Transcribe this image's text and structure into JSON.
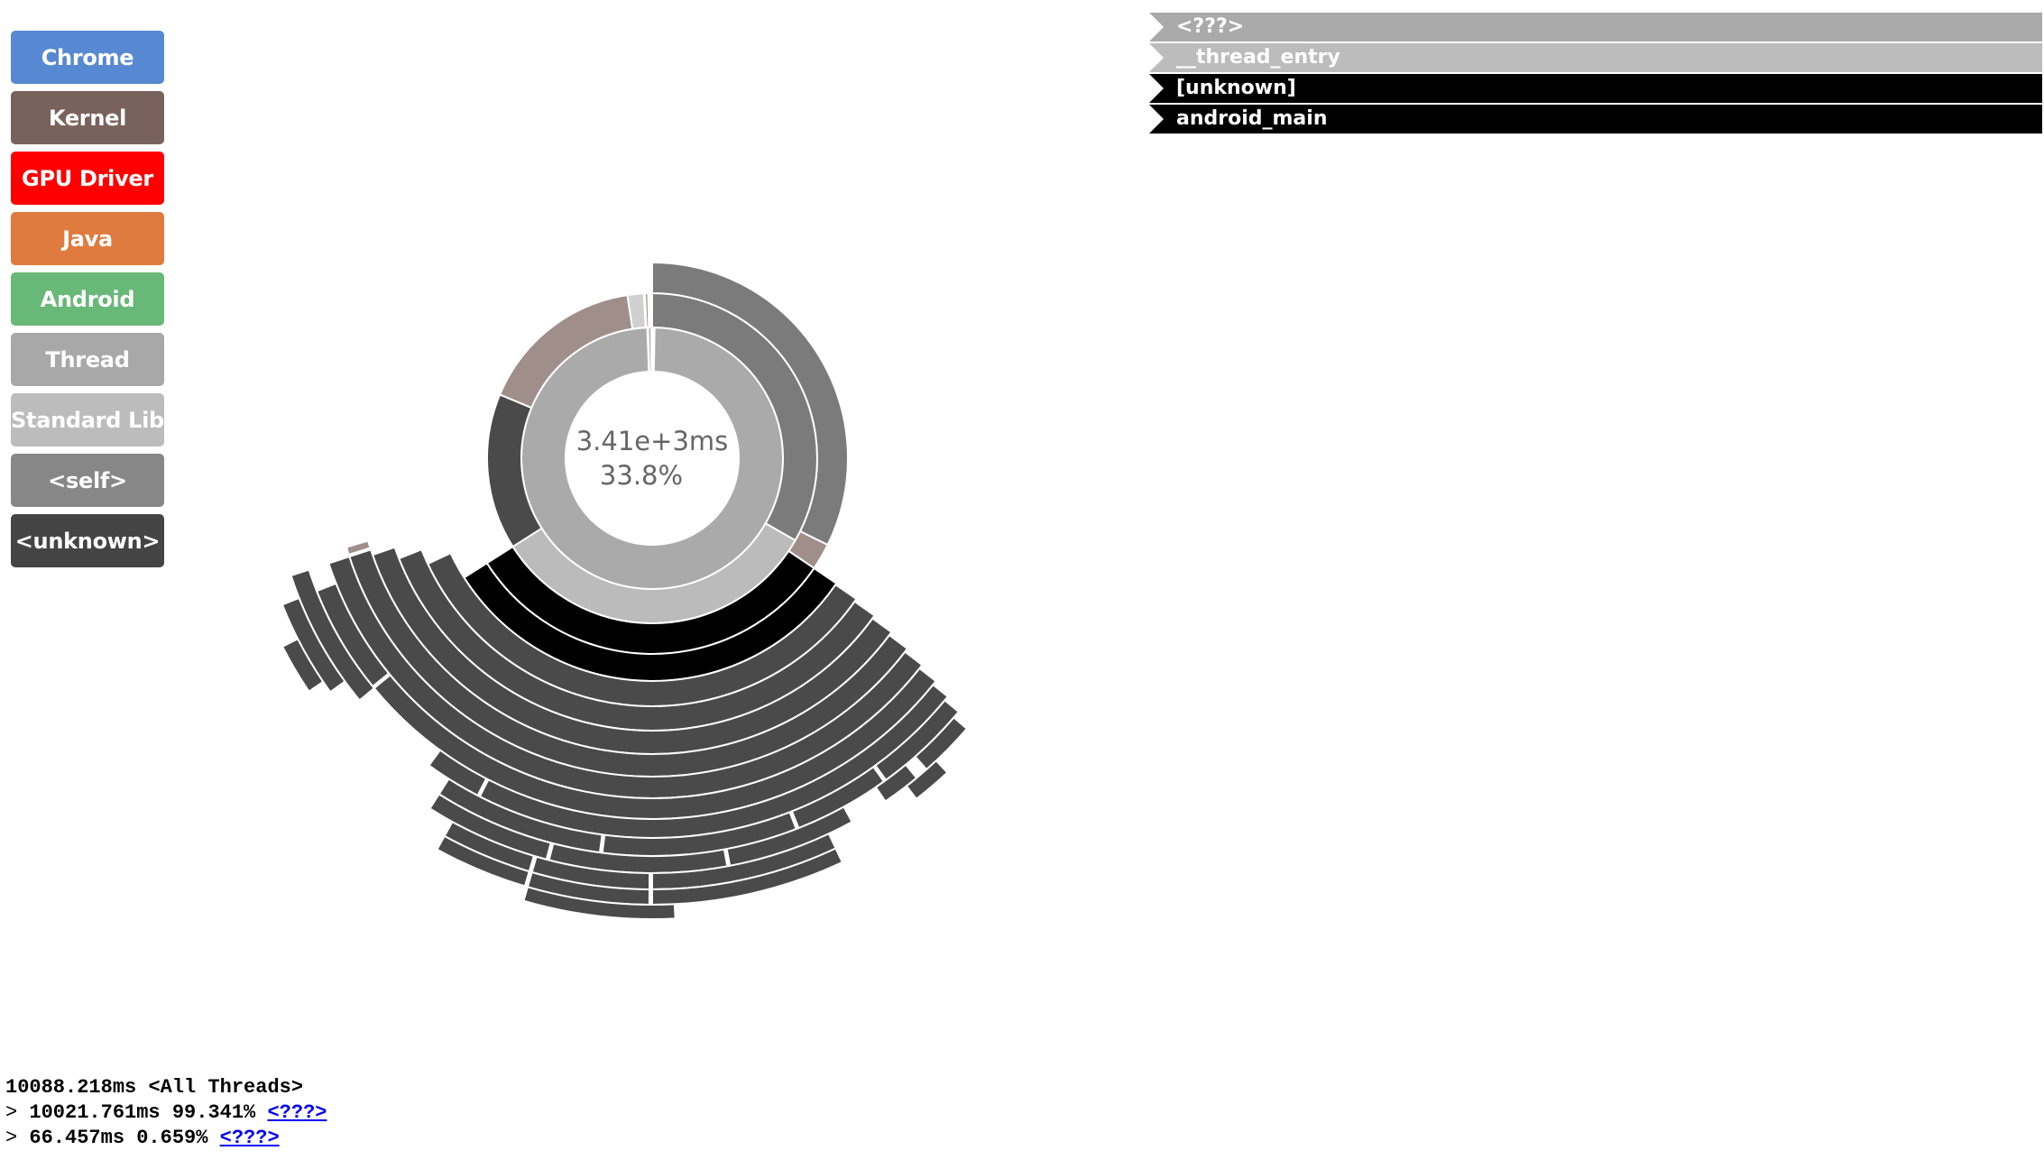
{
  "legend": [
    {
      "label": "Chrome",
      "color": "#5689d1"
    },
    {
      "label": "Kernel",
      "color": "#7a625c"
    },
    {
      "label": "GPU Driver",
      "color": "#ff0000"
    },
    {
      "label": "Java",
      "color": "#df7b3e"
    },
    {
      "label": "Android",
      "color": "#68b877"
    },
    {
      "label": "Thread",
      "color": "#a8a8a8"
    },
    {
      "label": "Standard Lib",
      "color": "#bcbcbc"
    },
    {
      "label": "<self>",
      "color": "#878787"
    },
    {
      "label": "<unknown>",
      "color": "#444444"
    }
  ],
  "breadcrumbs": [
    {
      "label": "<???>",
      "color": "#aaaaaa"
    },
    {
      "label": "__thread_entry",
      "color": "#bcbcbc"
    },
    {
      "label": "[unknown]",
      "color": "#000000"
    },
    {
      "label": "android_main",
      "color": "#000000"
    }
  ],
  "center": {
    "time": "3.41e+3ms",
    "percent": "33.8%"
  },
  "stack": {
    "root": {
      "time": "10088.218ms",
      "name": "<All Threads>"
    },
    "children": [
      {
        "prefix": ">",
        "time": "10021.761ms",
        "percent": "99.341%",
        "link": "<???>"
      },
      {
        "prefix": ">",
        "time": "66.457ms",
        "percent": "0.659%",
        "link": "<???>"
      }
    ]
  },
  "chart_data": {
    "type": "sunburst",
    "units": "fraction of full circle, clockwise from 12 o'clock",
    "arcs": [
      {
        "depth": 1,
        "start": 0.003,
        "end": 0.994,
        "color": "#aaaaaa"
      },
      {
        "depth": 1,
        "start": 0.995,
        "end": 0.999,
        "color": "#aaaaaa"
      },
      {
        "depth": 2,
        "start": 0.0,
        "end": 0.333,
        "color": "#7b7b7b"
      },
      {
        "depth": 2,
        "start": 0.333,
        "end": 0.66,
        "color": "#bbbbbb"
      },
      {
        "depth": 2,
        "start": 0.66,
        "end": 0.813,
        "color": "#4a4a4a"
      },
      {
        "depth": 2,
        "start": 0.813,
        "end": 0.976,
        "color": "#a08e8b"
      },
      {
        "depth": 2,
        "start": 0.976,
        "end": 0.992,
        "color": "#d0d0d0"
      },
      {
        "depth": 2,
        "start": 0.993,
        "end": 0.996,
        "color": "#a08e8b"
      },
      {
        "depth": 3,
        "start": 0.0,
        "end": 0.323,
        "color": "#7b7b7b"
      },
      {
        "depth": 3,
        "start": 0.323,
        "end": 0.345,
        "color": "#a08e8b"
      },
      {
        "depth": 3,
        "start": 0.345,
        "end": 0.66,
        "color": "#000000"
      },
      {
        "depth": 4,
        "start": 0.345,
        "end": 0.66,
        "color": "#000000"
      },
      {
        "depth": 5,
        "start": 0.346,
        "end": 0.68,
        "color": "#4a4a4a"
      },
      {
        "depth": 6,
        "start": 0.348,
        "end": 0.69,
        "color": "#4a4a4a"
      },
      {
        "depth": 7,
        "start": 0.35,
        "end": 0.697,
        "color": "#4a4a4a"
      },
      {
        "depth": 8,
        "start": 0.352,
        "end": 0.7,
        "color": "#4a4a4a"
      },
      {
        "depth": 8,
        "start": 0.701,
        "end": 0.705,
        "color": "#a08e8b"
      },
      {
        "depth": 9,
        "start": 0.354,
        "end": 0.7,
        "color": "#4a4a4a"
      },
      {
        "depth": 10,
        "start": 0.356,
        "end": 0.64,
        "color": "#4a4a4a"
      },
      {
        "depth": 10,
        "start": 0.641,
        "end": 0.69,
        "color": "#4a4a4a"
      },
      {
        "depth": 11,
        "start": 0.358,
        "end": 0.575,
        "color": "#4a4a4a"
      },
      {
        "depth": 11,
        "start": 0.576,
        "end": 0.6,
        "color": "#4a4a4a"
      },
      {
        "depth": 11,
        "start": 0.64,
        "end": 0.7,
        "color": "#4a4a4a"
      },
      {
        "depth": 12,
        "start": 0.36,
        "end": 0.4,
        "color": "#4a4a4a"
      },
      {
        "depth": 12,
        "start": 0.401,
        "end": 0.44,
        "color": "#4a4a4a"
      },
      {
        "depth": 12,
        "start": 0.441,
        "end": 0.52,
        "color": "#4a4a4a"
      },
      {
        "depth": 12,
        "start": 0.521,
        "end": 0.59,
        "color": "#4a4a4a"
      },
      {
        "depth": 12,
        "start": 0.65,
        "end": 0.69,
        "color": "#4a4a4a"
      },
      {
        "depth": 13,
        "start": 0.363,
        "end": 0.385,
        "color": "#4a4a4a"
      },
      {
        "depth": 13,
        "start": 0.39,
        "end": 0.405,
        "color": "#4a4a4a"
      },
      {
        "depth": 13,
        "start": 0.42,
        "end": 0.47,
        "color": "#4a4a4a"
      },
      {
        "depth": 13,
        "start": 0.471,
        "end": 0.54,
        "color": "#4a4a4a"
      },
      {
        "depth": 13,
        "start": 0.541,
        "end": 0.59,
        "color": "#4a4a4a"
      },
      {
        "depth": 13,
        "start": 0.655,
        "end": 0.675,
        "color": "#4a4a4a"
      },
      {
        "depth": 14,
        "start": 0.38,
        "end": 0.395,
        "color": "#4a4a4a"
      },
      {
        "depth": 14,
        "start": 0.43,
        "end": 0.5,
        "color": "#4a4a4a"
      },
      {
        "depth": 14,
        "start": 0.501,
        "end": 0.545,
        "color": "#4a4a4a"
      },
      {
        "depth": 14,
        "start": 0.546,
        "end": 0.58,
        "color": "#4a4a4a"
      },
      {
        "depth": 15,
        "start": 0.43,
        "end": 0.5,
        "color": "#4a4a4a"
      },
      {
        "depth": 15,
        "start": 0.501,
        "end": 0.545,
        "color": "#4a4a4a"
      },
      {
        "depth": 15,
        "start": 0.546,
        "end": 0.58,
        "color": "#4a4a4a"
      },
      {
        "depth": 16,
        "start": 0.492,
        "end": 0.545,
        "color": "#4a4a4a"
      }
    ]
  }
}
